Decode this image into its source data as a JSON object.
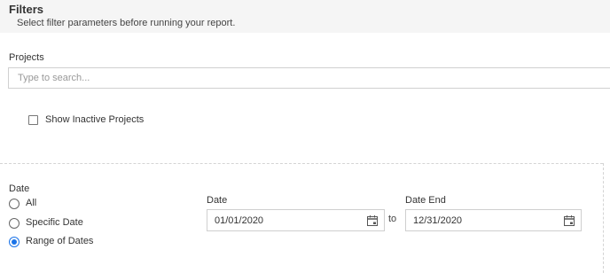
{
  "header": {
    "title": "Filters",
    "subtitle": "Select filter parameters before running your report."
  },
  "projects": {
    "label": "Projects",
    "search_placeholder": "Type to search...",
    "show_inactive_label": "Show Inactive Projects",
    "show_inactive_checked": false
  },
  "date_filter": {
    "label": "Date",
    "options": [
      {
        "label": "All",
        "selected": false
      },
      {
        "label": "Specific Date",
        "selected": false
      },
      {
        "label": "Range of Dates",
        "selected": true
      }
    ],
    "start_label": "Date",
    "start_value": "01/01/2020",
    "to_label": "to",
    "end_label": "Date End",
    "end_value": "12/31/2020"
  },
  "colors": {
    "header_bg": "#f5f5f5",
    "accent": "#1a73e8",
    "border": "#d0d0d0",
    "text": "#333333"
  },
  "icons": [
    "calendar-icon"
  ]
}
